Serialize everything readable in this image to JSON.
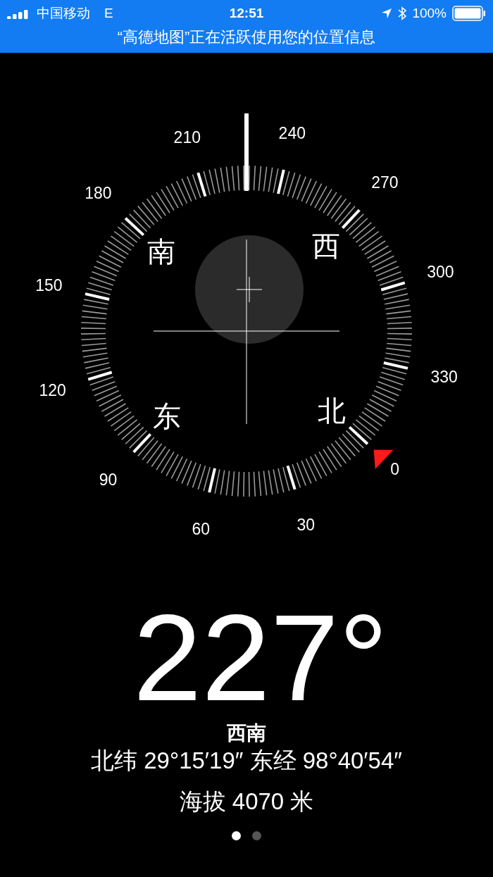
{
  "status_bar": {
    "carrier": "中国移动",
    "network": "E",
    "time": "12:51",
    "battery": "100%"
  },
  "location_banner": "“高德地图”正在活跃使用您的位置信息",
  "compass": {
    "degree_labels": [
      "0",
      "30",
      "60",
      "90",
      "120",
      "150",
      "180",
      "210",
      "240",
      "270",
      "300",
      "330"
    ],
    "cardinals": [
      {
        "kind": "south",
        "label": "南"
      },
      {
        "kind": "west",
        "label": "西"
      },
      {
        "kind": "east",
        "label": "东"
      },
      {
        "kind": "north",
        "label": "北"
      }
    ]
  },
  "heading": "227°",
  "direction": "西南",
  "coordinates": "北纬 29°15′19″ 东经 98°40′54″",
  "altitude": "海拔 4070 米",
  "page_dots": [
    {
      "selected": true
    },
    {
      "selected": false
    }
  ]
}
